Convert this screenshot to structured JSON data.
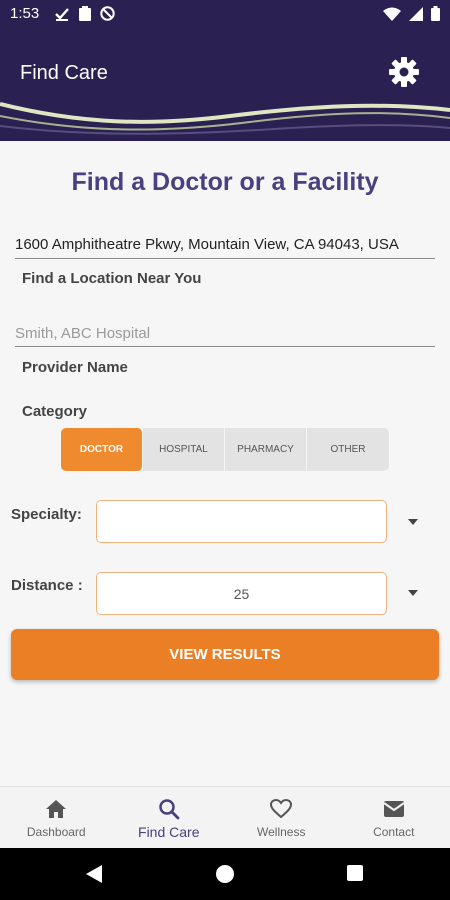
{
  "status_bar": {
    "time": "1:53",
    "left_icons": [
      "check-icon",
      "clipboard-icon",
      "at-icon"
    ],
    "right_icons": [
      "wifi-icon",
      "signal-icon",
      "battery-icon"
    ]
  },
  "app_bar": {
    "title": "Find Care",
    "settings_icon": "gear-icon"
  },
  "page": {
    "title": "Find a Doctor or a Facility"
  },
  "location": {
    "value": "1600 Amphitheatre Pkwy, Mountain View, CA 94043, USA",
    "label": "Find a Location Near You"
  },
  "provider": {
    "placeholder": "Smith, ABC Hospital",
    "label": "Provider Name"
  },
  "category": {
    "label": "Category",
    "options": [
      "DOCTOR",
      "HOSPITAL",
      "PHARMACY",
      "OTHER"
    ],
    "selected": "DOCTOR"
  },
  "specialty": {
    "label": "Specialty:",
    "value": ""
  },
  "distance": {
    "label": "Distance :",
    "value": "25"
  },
  "view_results": {
    "label": "VIEW RESULTS"
  },
  "bottom_nav": {
    "items": [
      {
        "label": "Dashboard",
        "icon": "home-icon"
      },
      {
        "label": "Find Care",
        "icon": "search-icon"
      },
      {
        "label": "Wellness",
        "icon": "heart-icon"
      },
      {
        "label": "Contact",
        "icon": "mail-icon"
      }
    ],
    "active": "Find Care"
  },
  "colors": {
    "brand_dark": "#2a2152",
    "title_purple": "#4a3f7f",
    "accent_orange": "#ea7f26"
  }
}
